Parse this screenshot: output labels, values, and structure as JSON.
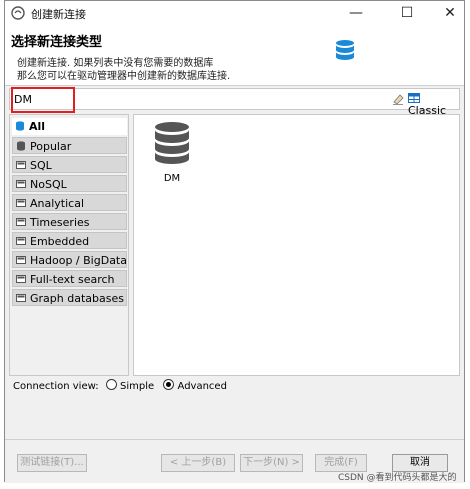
{
  "window": {
    "title": "创建新连接",
    "buttons": {
      "minimize": "—",
      "maximize": "☐",
      "close": "✕"
    }
  },
  "header": {
    "title": "选择新连接类型",
    "desc_line1": "创建新连接. 如果列表中没有您需要的数据库",
    "desc_line2": "那么您可以在驱动管理器中创建新的数据库连接."
  },
  "search": {
    "value": "DM"
  },
  "toolbar": {
    "classic_label": "Classic"
  },
  "categories": [
    {
      "label": "All",
      "selected": true
    },
    {
      "label": "Popular",
      "selected": false
    },
    {
      "label": "SQL",
      "selected": false
    },
    {
      "label": "NoSQL",
      "selected": false
    },
    {
      "label": "Analytical",
      "selected": false
    },
    {
      "label": "Timeseries",
      "selected": false
    },
    {
      "label": "Embedded",
      "selected": false
    },
    {
      "label": "Hadoop / BigData",
      "selected": false
    },
    {
      "label": "Full-text search",
      "selected": false
    },
    {
      "label": "Graph databases",
      "selected": false
    }
  ],
  "drivers": [
    {
      "label": "DM",
      "icon": "database-icon"
    }
  ],
  "connection_view": {
    "label": "Connection view:",
    "options": [
      {
        "label": "Simple",
        "checked": false
      },
      {
        "label": "Advanced",
        "checked": true
      }
    ]
  },
  "footer": {
    "test_button": "测试链接(T)...",
    "back_button": "< 上一步(B)",
    "next_button": "下一步(N) >",
    "finish_button": "完成(F)",
    "cancel_button": "取消"
  },
  "watermark": "CSDN @看到代码头都是大的",
  "colors": {
    "accent": "#1a8ad8",
    "highlight": "#e02020",
    "panel_bg": "#f0f0f0"
  }
}
